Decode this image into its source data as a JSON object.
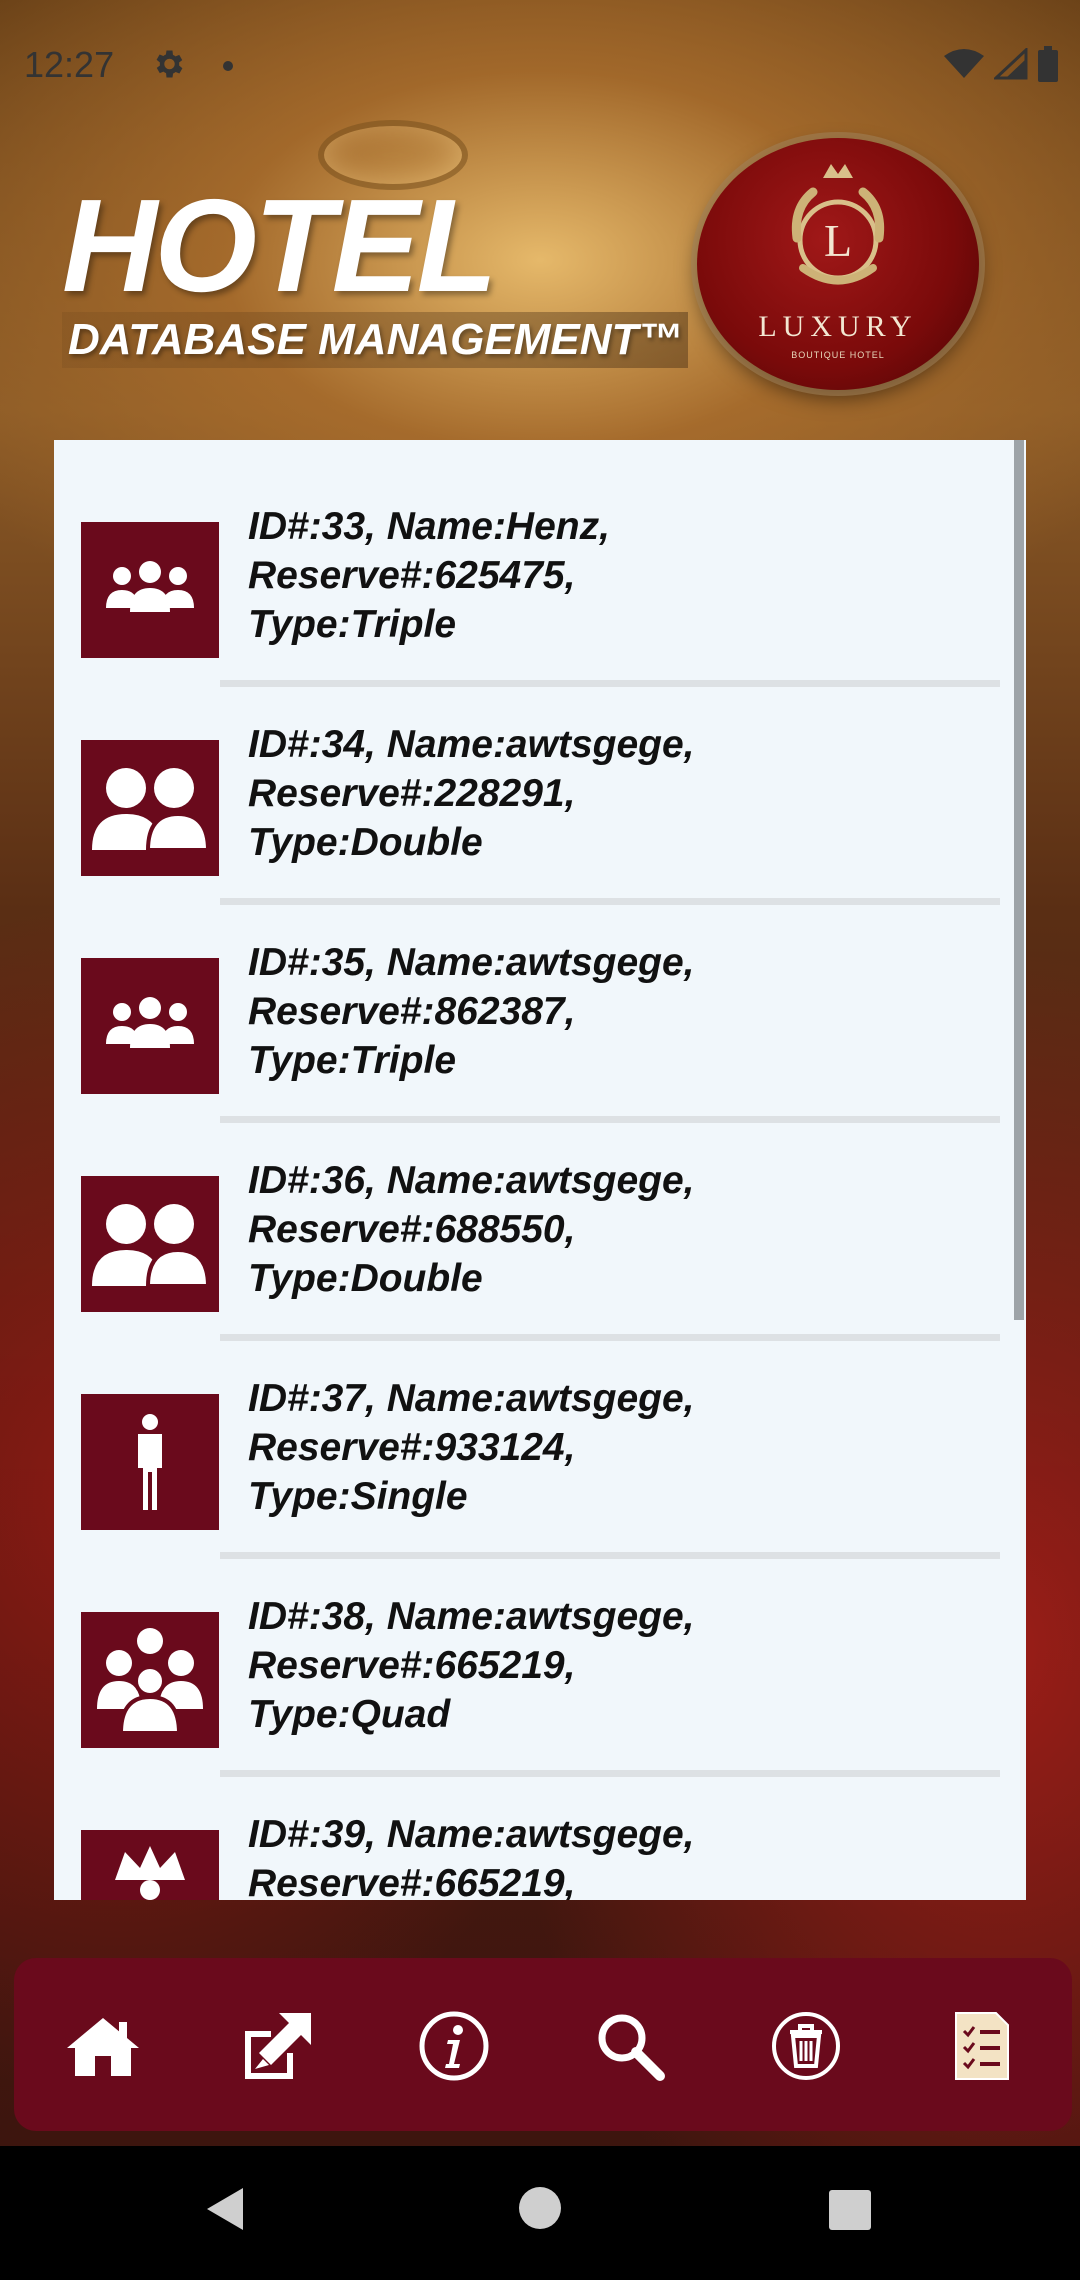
{
  "status_bar": {
    "time": "12:27",
    "icons": [
      "gear-icon",
      "notification-dot-icon",
      "wifi-icon",
      "signal-icon",
      "battery-icon"
    ]
  },
  "header": {
    "title": "HOTEL",
    "subtitle": "DATABASE MANAGEMENT™",
    "logo": {
      "monogram": "L",
      "word": "LUXURY",
      "tagline": "BOUTIQUE HOTEL"
    }
  },
  "reservations": [
    {
      "line1": "ID#:33, Name:Henz,",
      "line2": "Reserve#:625475,",
      "line3": "Type:Triple",
      "icon": "triple-room-icon"
    },
    {
      "line1": "ID#:34, Name:awtsgege,",
      "line2": "Reserve#:228291,",
      "line3": "Type:Double",
      "icon": "double-room-icon"
    },
    {
      "line1": "ID#:35, Name:awtsgege,",
      "line2": "Reserve#:862387,",
      "line3": "Type:Triple",
      "icon": "triple-room-icon"
    },
    {
      "line1": "ID#:36, Name:awtsgege,",
      "line2": "Reserve#:688550,",
      "line3": "Type:Double",
      "icon": "double-room-icon"
    },
    {
      "line1": "ID#:37, Name:awtsgege,",
      "line2": "Reserve#:933124,",
      "line3": "Type:Single",
      "icon": "single-room-icon"
    },
    {
      "line1": "ID#:38, Name:awtsgege,",
      "line2": "Reserve#:665219,",
      "line3": "Type:Quad",
      "icon": "quad-room-icon"
    },
    {
      "line1": "ID#:39, Name:awtsgege,",
      "line2": "Reserve#:665219,",
      "line3": "",
      "icon": "suite-room-icon"
    }
  ],
  "bottom_nav": [
    {
      "icon": "home-icon"
    },
    {
      "icon": "edit-icon"
    },
    {
      "icon": "info-icon"
    },
    {
      "icon": "search-icon"
    },
    {
      "icon": "delete-icon"
    },
    {
      "icon": "list-icon"
    }
  ],
  "colors": {
    "brand": "#6a0a1c",
    "panel": "#f1f7fb",
    "text": "#111111",
    "list_icon_accent": "#f3e3c4"
  }
}
